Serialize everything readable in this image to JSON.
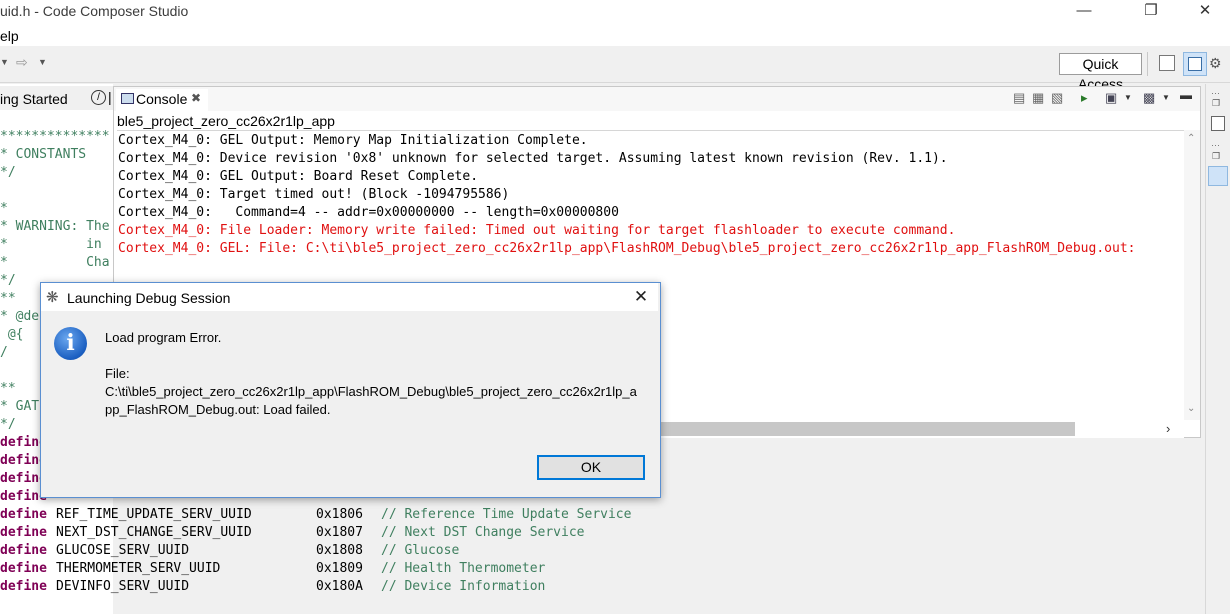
{
  "window": {
    "title": "uid.h - Code Composer Studio",
    "minimize_icon": "minimize-icon",
    "restore_icon": "restore-icon",
    "close_icon": "close-icon"
  },
  "menu": {
    "help_label": "elp"
  },
  "toolbar": {
    "quick_access_label": "Quick Access"
  },
  "left_view": {
    "tab_label": "ing Started",
    "code_lines": [
      {
        "text": "**************",
        "color": "#3f7f5f"
      },
      {
        "text": "* CONSTANTS",
        "color": "#3f7f5f"
      },
      {
        "text": "*/",
        "color": "#3f7f5f"
      },
      {
        "text": "",
        "color": "#3f7f5f"
      },
      {
        "text": "*",
        "color": "#3f7f5f"
      },
      {
        "text": "* WARNING: The",
        "color": "#3f7f5f"
      },
      {
        "text": "*          in",
        "color": "#3f7f5f"
      },
      {
        "text": "*          Cha",
        "color": "#3f7f5f"
      },
      {
        "text": "*/",
        "color": "#3f7f5f"
      },
      {
        "text": "**",
        "color": "#3f7f5f"
      },
      {
        "text": "* @de",
        "color": "#3f7f5f"
      },
      {
        "text": " @{",
        "color": "#3f7f5f"
      },
      {
        "text": "/",
        "color": "#3f7f5f"
      },
      {
        "text": "",
        "color": "#3f7f5f"
      },
      {
        "text": "**",
        "color": "#3f7f5f"
      },
      {
        "text": "* GAT",
        "color": "#3f7f5f"
      },
      {
        "text": "*/",
        "color": "#3f7f5f"
      }
    ],
    "defines": [
      {
        "kw": "define",
        "name": "",
        "value": "",
        "comment": ""
      },
      {
        "kw": "define",
        "name": "",
        "value": "",
        "comment": ""
      },
      {
        "kw": "define",
        "name": "",
        "value": "",
        "comment": ""
      },
      {
        "kw": "define",
        "name": "",
        "value": "",
        "comment": ""
      },
      {
        "kw": "define",
        "name": "REF_TIME_UPDATE_SERV_UUID",
        "value": "0x1806",
        "comment": "// Reference Time Update Service"
      },
      {
        "kw": "define",
        "name": "NEXT_DST_CHANGE_SERV_UUID",
        "value": "0x1807",
        "comment": "// Next DST Change Service"
      },
      {
        "kw": "define",
        "name": "GLUCOSE_SERV_UUID",
        "value": "0x1808",
        "comment": "// Glucose"
      },
      {
        "kw": "define",
        "name": "THERMOMETER_SERV_UUID",
        "value": "0x1809",
        "comment": "// Health Thermometer"
      },
      {
        "kw": "define",
        "name": "DEVINFO_SERV_UUID",
        "value": "0x180A",
        "comment": "// Device Information"
      }
    ]
  },
  "console": {
    "tab_label": "Console",
    "context_label": "ble5_project_zero_cc26x2r1lp_app",
    "lines": [
      {
        "text": "Cortex_M4_0: GEL Output: Memory Map Initialization Complete.",
        "color": "#000000"
      },
      {
        "text": "Cortex_M4_0: Device revision '0x8' unknown for selected target. Assuming latest known revision (Rev. 1.1).",
        "color": "#000000"
      },
      {
        "text": "Cortex_M4_0: GEL Output: Board Reset Complete.",
        "color": "#000000"
      },
      {
        "text": "Cortex_M4_0: Target timed out! (Block -1094795586)",
        "color": "#000000"
      },
      {
        "text": "Cortex_M4_0:   Command=4 -- addr=0x00000000 -- length=0x00000800",
        "color": "#000000"
      },
      {
        "text": "Cortex_M4_0: File Loader: Memory write failed: Timed out waiting for target flashloader to execute command.",
        "color": "#e01010"
      },
      {
        "text": "Cortex_M4_0: GEL: File: C:\\ti\\ble5_project_zero_cc26x2r1lp_app\\FlashROM_Debug\\ble5_project_zero_cc26x2r1lp_app_FlashROM_Debug.out:",
        "color": "#e01010"
      }
    ]
  },
  "dialog": {
    "title": "Launching Debug Session",
    "message": "Load program Error.",
    "file_label": "File:",
    "file_line1": "C:\\ti\\ble5_project_zero_cc26x2r1lp_app\\FlashROM_Debug\\ble5_project_zero_cc26x2r1lp_a",
    "file_line2": "pp_FlashROM_Debug.out: Load failed.",
    "ok_label": "OK",
    "icon": "info-icon"
  },
  "colors": {
    "keyword": "#7f0055",
    "comment": "#3f7f5f",
    "error": "#e01010",
    "dialog_border": "#5a8fd1",
    "button_focus": "#0078d7"
  }
}
